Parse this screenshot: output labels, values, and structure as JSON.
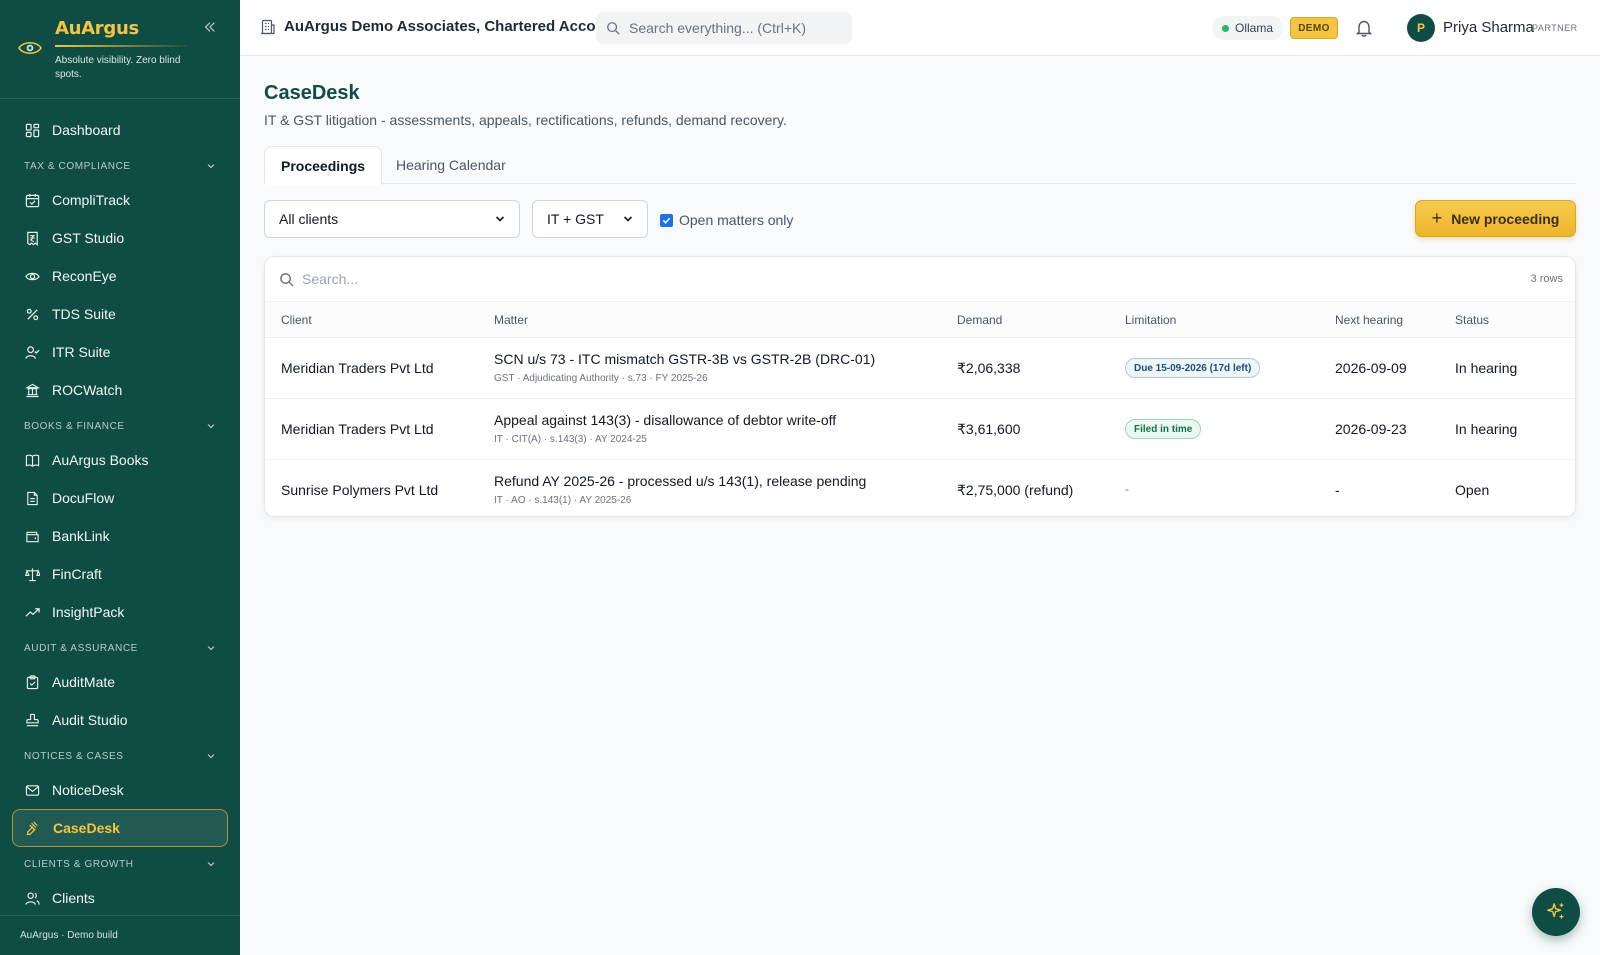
{
  "brand": {
    "name": "AuArgus",
    "tagline": "Absolute visibility. Zero blind spots."
  },
  "sidebar": {
    "top_item": {
      "label": "Dashboard",
      "icon": "dashboard-icon"
    },
    "sections": [
      {
        "title": "TAX & COMPLIANCE",
        "items": [
          {
            "label": "CompliTrack",
            "icon": "calendar-check-icon"
          },
          {
            "label": "GST Studio",
            "icon": "receipt-icon"
          },
          {
            "label": "ReconEye",
            "icon": "eye-icon"
          },
          {
            "label": "TDS Suite",
            "icon": "percent-icon"
          },
          {
            "label": "ITR Suite",
            "icon": "user-check-icon"
          },
          {
            "label": "ROCWatch",
            "icon": "building-icon"
          }
        ]
      },
      {
        "title": "BOOKS & FINANCE",
        "items": [
          {
            "label": "AuArgus Books",
            "icon": "book-icon"
          },
          {
            "label": "DocuFlow",
            "icon": "document-icon"
          },
          {
            "label": "BankLink",
            "icon": "wallet-icon"
          },
          {
            "label": "FinCraft",
            "icon": "scale-icon"
          },
          {
            "label": "InsightPack",
            "icon": "trend-icon"
          }
        ]
      },
      {
        "title": "AUDIT & ASSURANCE",
        "items": [
          {
            "label": "AuditMate",
            "icon": "clipboard-icon"
          },
          {
            "label": "Audit Studio",
            "icon": "stamp-icon"
          }
        ]
      },
      {
        "title": "NOTICES & CASES",
        "items": [
          {
            "label": "NoticeDesk",
            "icon": "mail-icon"
          },
          {
            "label": "CaseDesk",
            "icon": "gavel-icon",
            "active": true
          }
        ]
      },
      {
        "title": "CLIENTS & GROWTH",
        "items": [
          {
            "label": "Clients",
            "icon": "users-icon"
          }
        ]
      }
    ],
    "footer": "AuArgus · Demo build"
  },
  "topbar": {
    "firm": "AuArgus Demo Associates, Chartered Accou...",
    "search_placeholder": "Search everything...  (Ctrl+K)",
    "ollama": "Ollama",
    "demo": "DEMO",
    "user_initial": "P",
    "user_name": "Priya Sharma",
    "user_role": "PARTNER"
  },
  "page": {
    "title": "CaseDesk",
    "subtitle": "IT & GST litigation - assessments, appeals, rectifications, refunds, demand recovery."
  },
  "tabs": [
    "Proceedings",
    "Hearing Calendar"
  ],
  "filters": {
    "client": "All clients",
    "type": "IT + GST",
    "open_only_label": "Open matters only",
    "open_only_checked": true,
    "new_button": "New proceeding"
  },
  "table": {
    "search_placeholder": "Search...",
    "row_count": "3 rows",
    "columns": [
      "Client",
      "Matter",
      "Demand",
      "Limitation",
      "Next hearing",
      "Status"
    ],
    "rows": [
      {
        "client": "Meridian Traders Pvt Ltd",
        "matter": "SCN u/s 73 - ITC mismatch GSTR-3B vs GSTR-2B (DRC-01)",
        "matter_sub": "GST · Adjudicating Authority · s.73 · FY 2025-26",
        "demand": "₹2,06,338",
        "limitation": "Due 15-09-2026 (17d left)",
        "limitation_kind": "due",
        "next_hearing": "2026-09-09",
        "status": "In hearing"
      },
      {
        "client": "Meridian Traders Pvt Ltd",
        "matter": "Appeal against 143(3) - disallowance of debtor write-off",
        "matter_sub": "IT · CIT(A) · s.143(3) · AY 2024-25",
        "demand": "₹3,61,600",
        "limitation": "Filed in time",
        "limitation_kind": "ok",
        "next_hearing": "2026-09-23",
        "status": "In hearing"
      },
      {
        "client": "Sunrise Polymers Pvt Ltd",
        "matter": "Refund AY 2025-26 - processed u/s 143(1), release pending",
        "matter_sub": "IT · AO · s.143(1) · AY 2025-26",
        "demand": "₹2,75,000 (refund)",
        "limitation": "-",
        "limitation_kind": "none",
        "next_hearing": "-",
        "status": "Open"
      }
    ]
  },
  "colors": {
    "sidebar_bg": "#0f4c44",
    "accent_gold": "#f4c443",
    "title_green": "#0f4c44"
  }
}
